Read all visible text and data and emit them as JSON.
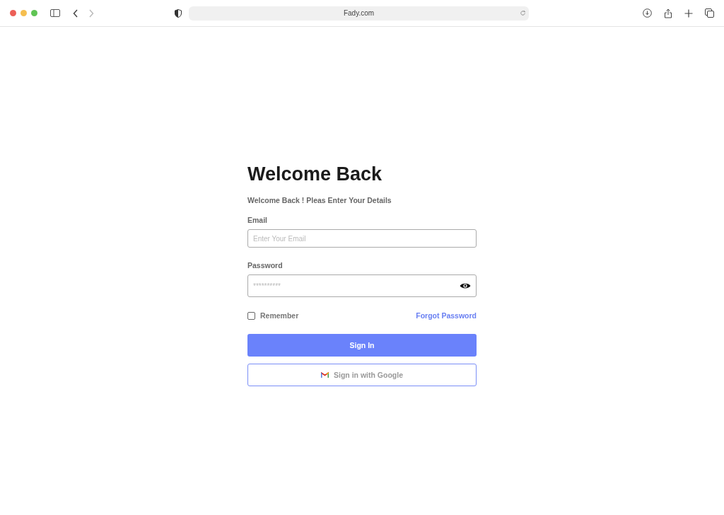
{
  "browser": {
    "url": "Fady.com",
    "forward_disabled": true
  },
  "login": {
    "title": "Welcome Back",
    "subtitle": "Welcome Back ! Pleas Enter Your Details",
    "email": {
      "label": "Email",
      "placeholder": "Enter Your Email"
    },
    "password": {
      "label": "Password",
      "placeholder": "**********"
    },
    "remember": {
      "label": "Remember",
      "checked": false
    },
    "forgot": "Forgot Password",
    "sign_in": "Sign In",
    "google": "Sign in with Google"
  }
}
